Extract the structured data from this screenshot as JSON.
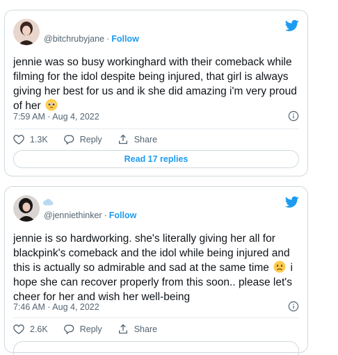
{
  "tweets": [
    {
      "handle": "@bitchrubyjane",
      "separator": "·",
      "follow_label": "Follow",
      "text_before_emoji": "jennie was so busy workinghard with their comeback while filming for the idol despite being injured, that girl is always giving her best for us and ik she did amazing i'm very proud of her ",
      "emoji": "pleading-face-emoji",
      "text_after_emoji": "",
      "timestamp": "7:59 AM · Aug 4, 2022",
      "like_count": "1.3K",
      "reply_label": "Reply",
      "share_label": "Share",
      "read_replies_label": "Read 17 replies"
    },
    {
      "handle": "@jenniethinker",
      "separator": "·",
      "follow_label": "Follow",
      "text_before_emoji": "jennie is so hardworking. she's literally giving her all for blackpink's comeback and the idol while being injured and this is actually so admirable and sad at the same time ",
      "emoji": "frowning-face-emoji",
      "text_after_emoji": " i hope she can recover properly from this soon.. please let's cheer for her and wish her well-being",
      "timestamp": "7:46 AM · Aug 4, 2022",
      "like_count": "2.6K",
      "reply_label": "Reply",
      "share_label": "Share"
    }
  ],
  "colors": {
    "accent": "#1d9bf0",
    "text": "#0f1419",
    "muted": "#536471",
    "border": "#cfd9de"
  }
}
